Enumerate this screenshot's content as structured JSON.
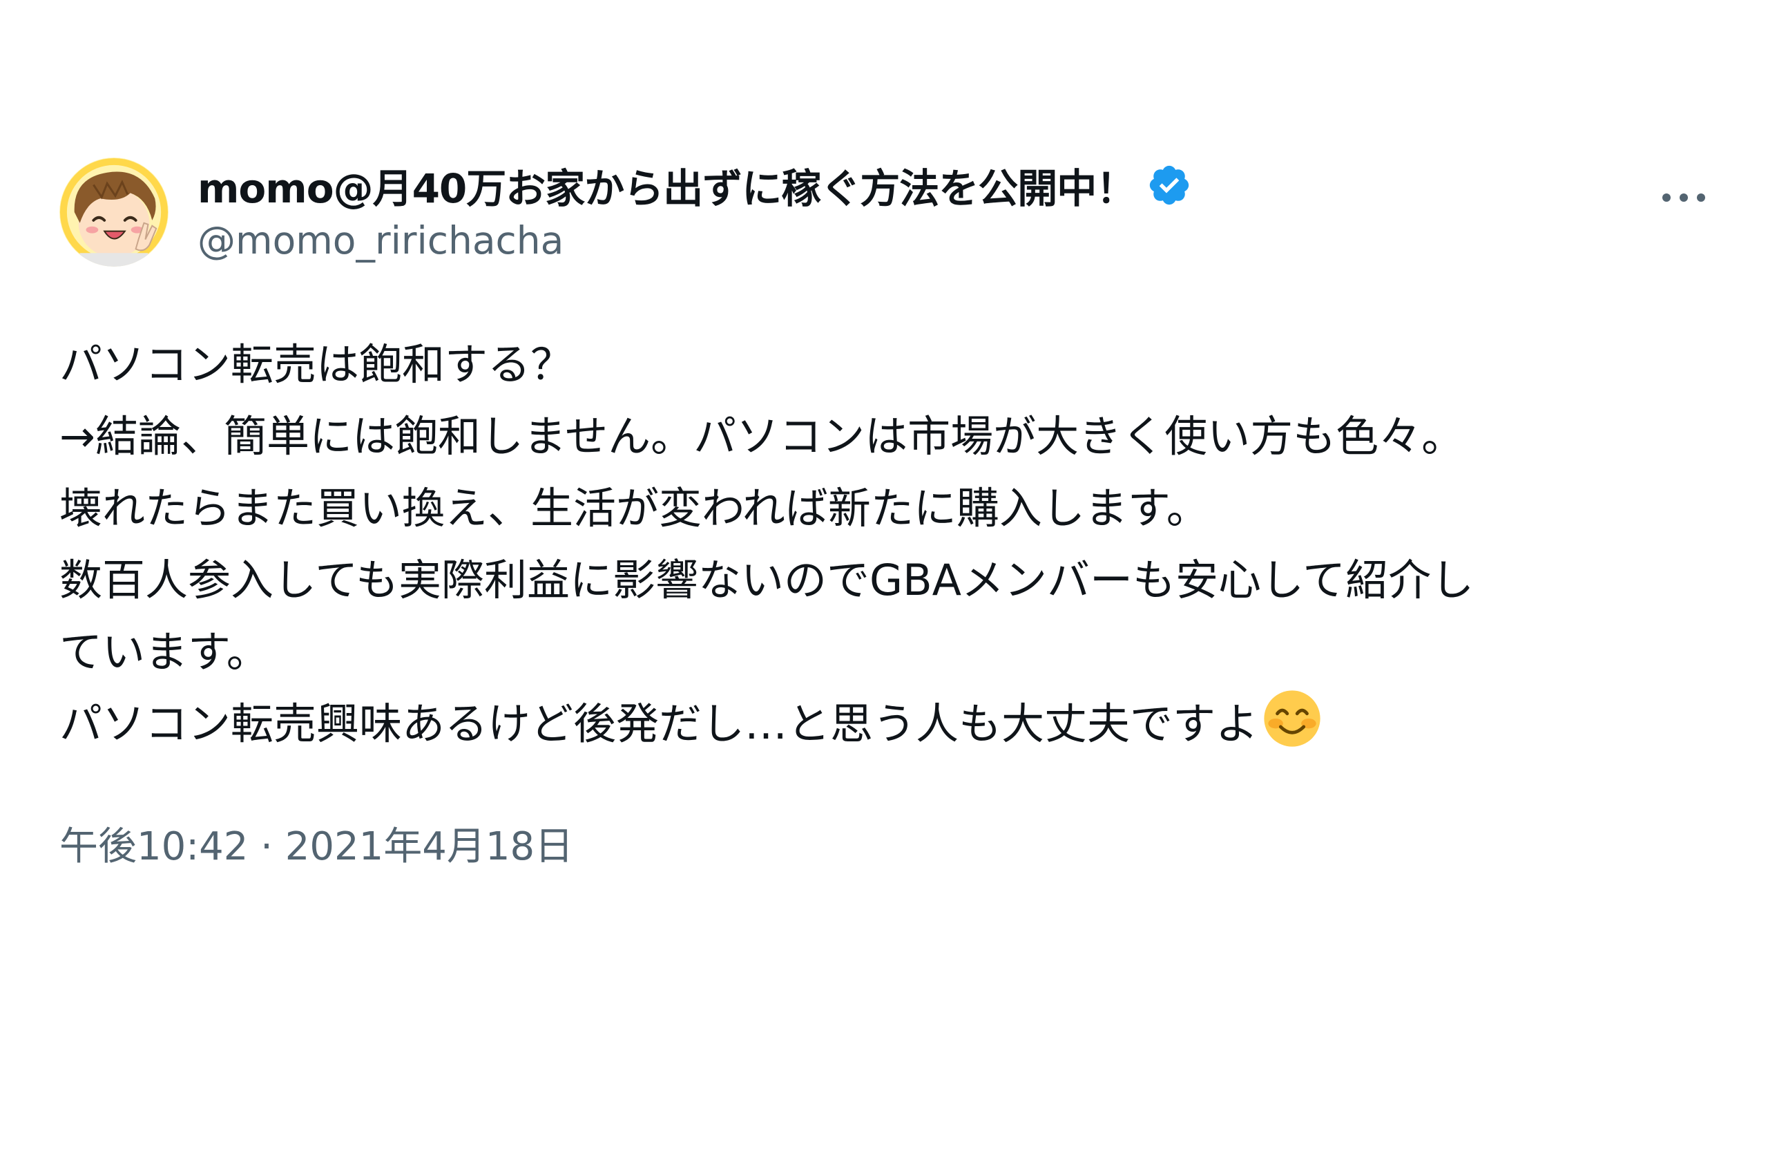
{
  "tweet": {
    "display_name": "momo@月40万お家から出ずに稼ぐ方法を公開中！",
    "handle": "@momo_ririchacha",
    "verified_icon": "verified-badge-icon",
    "more_icon": "more-options-icon",
    "lines": [
      "パソコン転売は飽和する？",
      "→結論、簡単には飽和しません。パソコンは市場が大きく使い方も色々。",
      "壊れたらまた買い換え、生活が変われば新たに購入します。",
      "数百人参入しても実際利益に影響ないのでGBAメンバーも安心して紹介し",
      "ています。",
      "パソコン転売興味あるけど後発だし…と思う人も大丈夫ですよ"
    ],
    "emoji": "smiling-face-emoji",
    "timestamp": "午後10:42 · 2021年4月18日"
  },
  "colors": {
    "text": "#0f1419",
    "secondary": "#536471",
    "verified": "#1d9bf0"
  }
}
